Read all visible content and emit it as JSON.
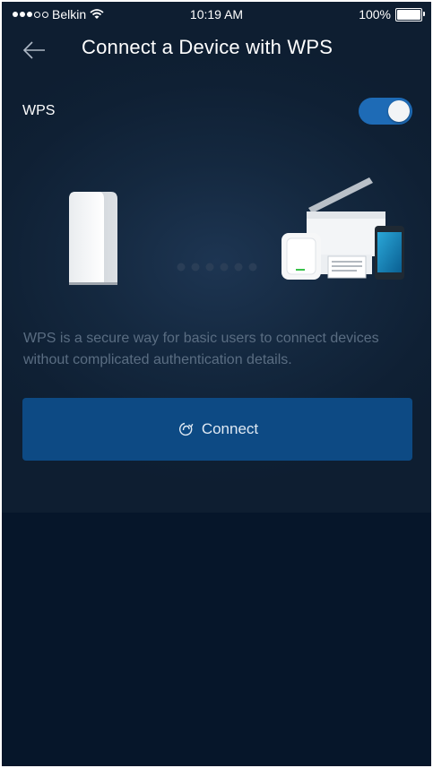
{
  "status_bar": {
    "carrier": "Belkin",
    "time": "10:19 AM",
    "battery": "100%"
  },
  "header": {
    "title": "Connect a Device with WPS"
  },
  "wps_toggle": {
    "label": "WPS",
    "enabled": true
  },
  "description": "WPS is a secure way for basic users to connect devices without complicated authentication details.",
  "connect_button": {
    "label": "Connect",
    "icon": "wps-icon"
  },
  "colors": {
    "background": "#06162a",
    "panel": "#14283f",
    "accent": "#1e6bb6",
    "button": "#0d4a84",
    "description_text": "#5a6d82"
  }
}
